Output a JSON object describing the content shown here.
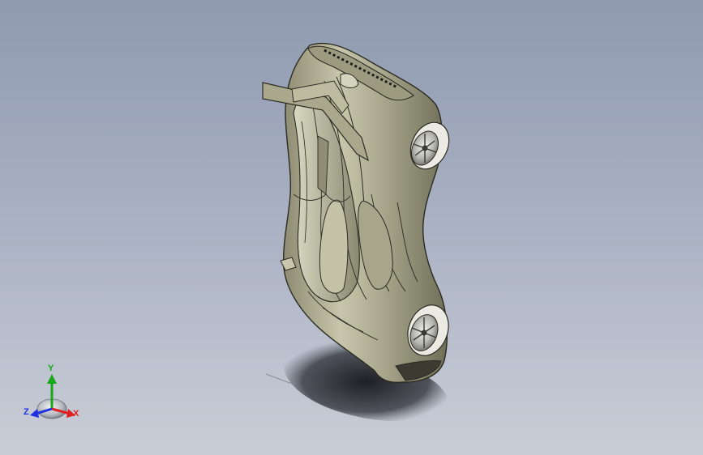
{
  "triad": {
    "y_label": "Y",
    "x_label": "X",
    "z_label": "Z",
    "colors": {
      "x": "#e02020",
      "y": "#1aa51a",
      "z": "#2030e0"
    }
  },
  "model": {
    "body_color": "#b6b59a",
    "edge_color": "#2b2b22",
    "shadow_color": "#1e1f23",
    "wheel_color": "#c9c9c4"
  },
  "background": {
    "top": "#8f9ab0",
    "bottom": "#c9cdd7"
  }
}
